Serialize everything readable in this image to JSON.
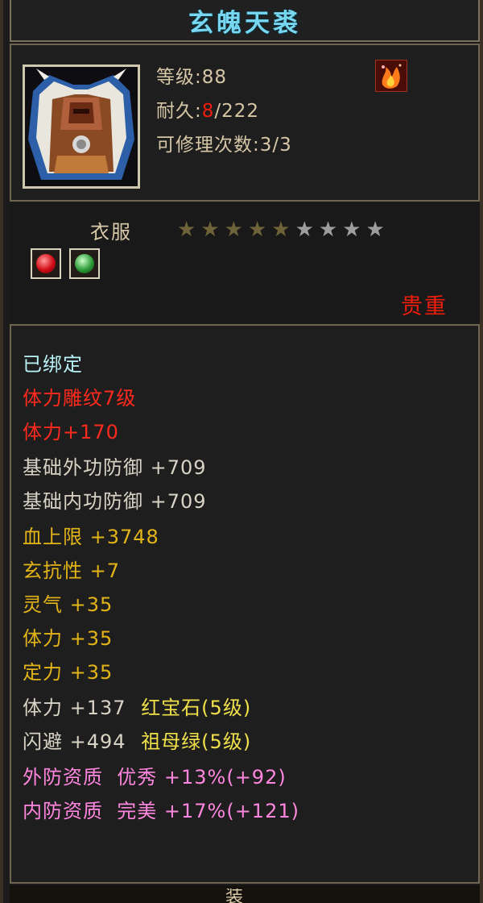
{
  "item": {
    "name": "玄魄天裘",
    "level_line": "等级:88",
    "durability_label": "耐久:",
    "durability_current": "8",
    "durability_max": "/222",
    "repairs_line": "可修理次数:3/3",
    "icon": "fur-armor-portrait-icon",
    "badge_icon": "fire-element-icon",
    "category": "衣服",
    "stars_total": 9,
    "stars_lit": 5,
    "gem_slots": [
      {
        "icon": "ruby-gem-icon",
        "color": "#d10c16"
      },
      {
        "icon": "emerald-gem-icon",
        "color": "#2c9a36"
      }
    ],
    "rarity": "贵重"
  },
  "stats": [
    {
      "text": "已绑定",
      "color": "#b9f2f6"
    },
    {
      "text": "体力雕纹7级",
      "color": "#ff2a1d"
    },
    {
      "text": "体力+170",
      "color": "#ff2a1d"
    },
    {
      "text": "基础外功防御 +709",
      "color": "#d8d3c4"
    },
    {
      "text": "基础内功防御 +709",
      "color": "#d8d3c4"
    },
    {
      "text": "血上限 +3748",
      "color": "#e3b417"
    },
    {
      "text": "玄抗性 +7",
      "color": "#e3b417"
    },
    {
      "text": "灵气 +35",
      "color": "#e3b417"
    },
    {
      "text": "体力 +35",
      "color": "#e3b417"
    },
    {
      "text": "定力 +35",
      "color": "#e3b417"
    },
    {
      "text": "体力 +137",
      "color": "#d8d3c4",
      "gem": "红宝石(5级)",
      "gem_color": "#f0e04a"
    },
    {
      "text": "闪避 +494",
      "color": "#d8d3c4",
      "gem": "祖母绿(5级)",
      "gem_color": "#f0e04a"
    },
    {
      "text": "外防资质  优秀 +13%(+92)",
      "color": "#ff86df"
    },
    {
      "text": "内防资质  完美 +17%(+121)",
      "color": "#ff86df"
    }
  ],
  "footer_char": "装"
}
